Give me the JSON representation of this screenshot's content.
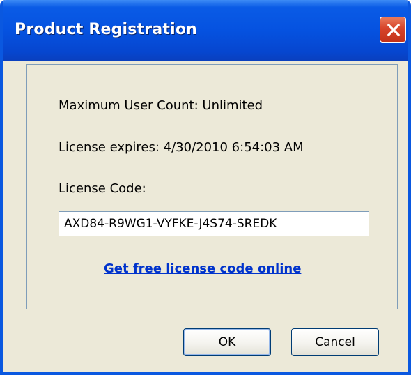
{
  "window": {
    "title": "Product Registration",
    "close_icon": "close-x-icon"
  },
  "info": {
    "max_user_count": "Maximum User Count: Unlimited",
    "license_expires": "License expires: 4/30/2010 6:54:03 AM",
    "license_code_label": "License Code:",
    "license_code_value": "AXD84-R9WG1-VYFKE-J4S74-SREDK",
    "free_license_link": "Get free license code online"
  },
  "buttons": {
    "ok_label": "OK",
    "cancel_label": "Cancel"
  },
  "colors": {
    "titlebar": "#0552e0",
    "close_button": "#d7442a",
    "dialog_background": "#ece9d8",
    "link": "#0033cc",
    "border": "#7f9db9"
  }
}
